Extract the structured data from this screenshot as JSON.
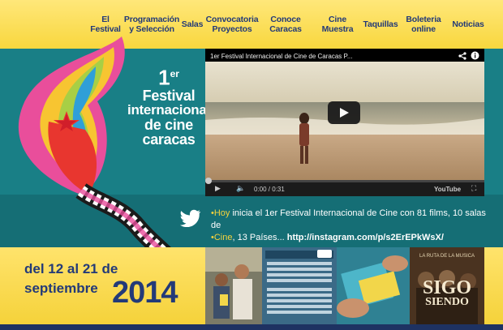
{
  "nav": {
    "items": [
      {
        "label": "El Festival"
      },
      {
        "label_line1": "Programación",
        "label_line2": "y Selección"
      },
      {
        "label": "Salas"
      },
      {
        "label_line1": "Convocatoria",
        "label_line2": "Proyectos"
      },
      {
        "label_line1": "Conoce",
        "label_line2": "Caracas"
      },
      {
        "label": "Cine Muestra"
      },
      {
        "label": "Taquillas"
      },
      {
        "label_line1": "Boleteria",
        "label_line2": "online"
      },
      {
        "label": "Noticias"
      }
    ]
  },
  "logo": {
    "line1_num": "1",
    "line1_sup": "er",
    "line2": "Festival",
    "line3": "internacional",
    "line4": "de cine",
    "line5": "caracas"
  },
  "video": {
    "title": "1er Festival Internacional de Cine de Caracas P...",
    "time_current": "0:00",
    "time_total": "0:31",
    "progress": 0,
    "brand": "YouTube"
  },
  "tweet": {
    "part1": "•Hoy",
    "part2": " inicia el 1er Festival Internacional de Cine con 81 films, 10 salas de",
    "part3": "•Cine",
    "part4": ", 13 Países... ",
    "link": "http://instagram.com/p/s2ErEPkWsX/"
  },
  "dates": {
    "line1": "del 12 al 21 de",
    "line2": "septiembre",
    "year": "2014"
  },
  "thumbs": [
    {
      "name": "photo-people"
    },
    {
      "name": "transport-routes"
    },
    {
      "name": "hands-tickets"
    },
    {
      "name": "sigo-siendo",
      "text_top": "LA RUTA DE LA MUSICA",
      "text_main": "SIGO",
      "text_sub": "SIENDO"
    }
  ],
  "colors": {
    "nav_text": "#233a78",
    "teal": "#197f86",
    "yellow": "#f8d73e",
    "footer": "#1e3262"
  }
}
